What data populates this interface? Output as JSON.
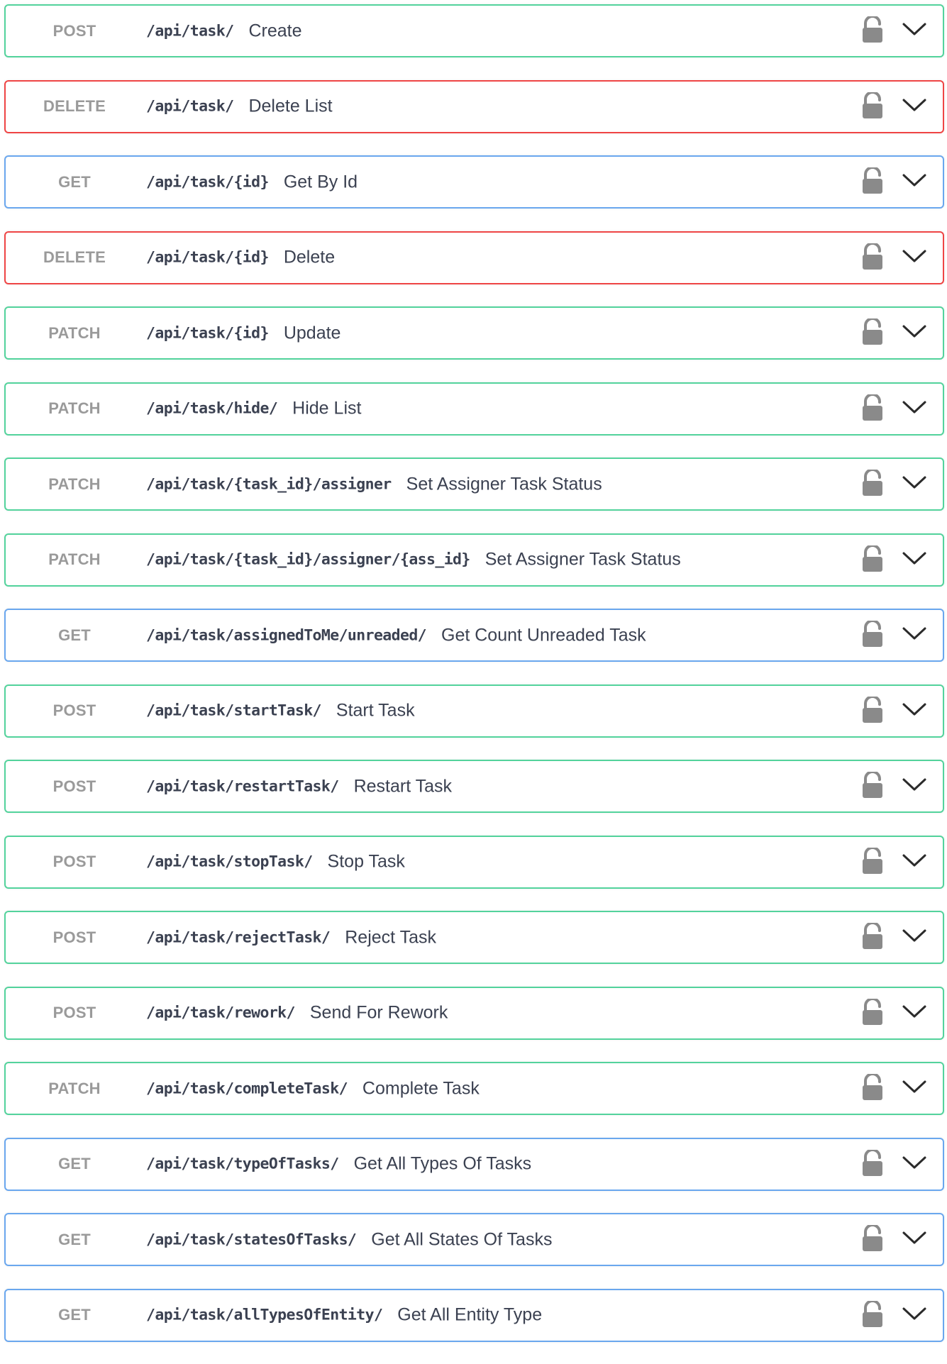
{
  "operations": [
    {
      "method": "POST",
      "kind": "post",
      "path": "/api/task/",
      "summary": "Create"
    },
    {
      "method": "DELETE",
      "kind": "delete",
      "path": "/api/task/",
      "summary": "Delete List"
    },
    {
      "method": "GET",
      "kind": "get",
      "path": "/api/task/{id}",
      "summary": "Get By Id"
    },
    {
      "method": "DELETE",
      "kind": "delete",
      "path": "/api/task/{id}",
      "summary": "Delete"
    },
    {
      "method": "PATCH",
      "kind": "patch",
      "path": "/api/task/{id}",
      "summary": "Update"
    },
    {
      "method": "PATCH",
      "kind": "patch",
      "path": "/api/task/hide/",
      "summary": "Hide List"
    },
    {
      "method": "PATCH",
      "kind": "patch",
      "path": "/api/task/{task_id}/assigner",
      "summary": "Set Assigner Task Status"
    },
    {
      "method": "PATCH",
      "kind": "patch",
      "path": "/api/task/{task_id}/assigner/{ass_id}",
      "summary": "Set Assigner Task Status"
    },
    {
      "method": "GET",
      "kind": "get",
      "path": "/api/task/assignedToMe/unreaded/",
      "summary": "Get Count Unreaded Task"
    },
    {
      "method": "POST",
      "kind": "post",
      "path": "/api/task/startTask/",
      "summary": "Start Task"
    },
    {
      "method": "POST",
      "kind": "post",
      "path": "/api/task/restartTask/",
      "summary": "Restart Task"
    },
    {
      "method": "POST",
      "kind": "post",
      "path": "/api/task/stopTask/",
      "summary": "Stop Task"
    },
    {
      "method": "POST",
      "kind": "post",
      "path": "/api/task/rejectTask/",
      "summary": "Reject Task"
    },
    {
      "method": "POST",
      "kind": "post",
      "path": "/api/task/rework/",
      "summary": "Send For Rework"
    },
    {
      "method": "PATCH",
      "kind": "patch",
      "path": "/api/task/completeTask/",
      "summary": "Complete Task"
    },
    {
      "method": "GET",
      "kind": "get",
      "path": "/api/task/typeOfTasks/",
      "summary": "Get All Types Of Tasks"
    },
    {
      "method": "GET",
      "kind": "get",
      "path": "/api/task/statesOfTasks/",
      "summary": "Get All States Of Tasks"
    },
    {
      "method": "GET",
      "kind": "get",
      "path": "/api/task/allTypesOfEntity/",
      "summary": "Get All Entity Type"
    }
  ],
  "icons": {
    "lock": "lock-icon",
    "expand": "chevron-down-icon"
  },
  "colors": {
    "post_border": "#53d39c",
    "patch_border": "#53d39c",
    "delete_border": "#ef4545",
    "get_border": "#6aa7ee",
    "method_text": "#9a9a9a",
    "text": "#3b4151",
    "icon": "#8a8a8a"
  }
}
